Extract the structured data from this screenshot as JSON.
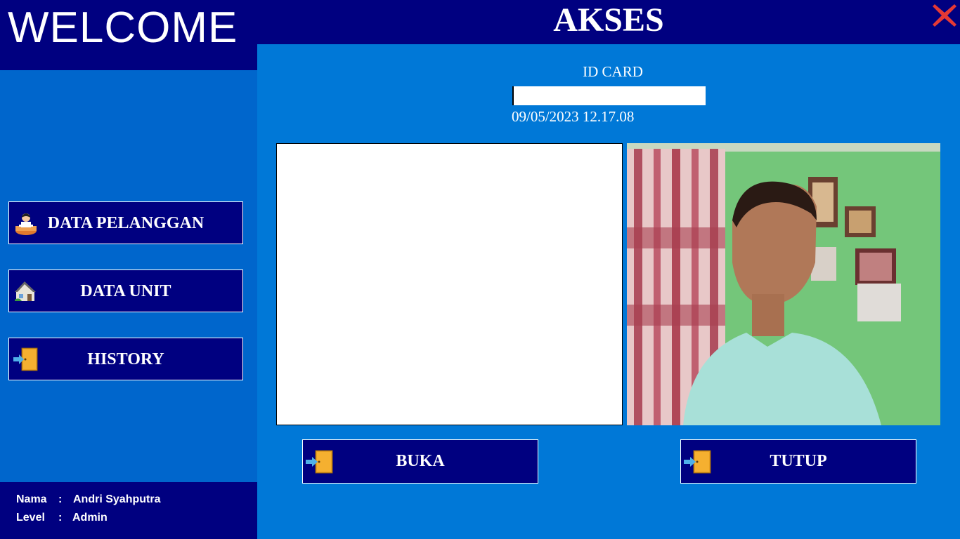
{
  "sidebar": {
    "welcome": "WELCOME",
    "nav": [
      {
        "label": "DATA PELANGGAN",
        "icon": "customer-icon"
      },
      {
        "label": "DATA UNIT",
        "icon": "house-icon"
      },
      {
        "label": "HISTORY",
        "icon": "door-exit-icon"
      }
    ],
    "user": {
      "name_label": "Nama",
      "name_value": "Andri Syahputra",
      "level_label": "Level",
      "level_value": "Admin",
      "separator": ":"
    }
  },
  "main": {
    "title": "AKSES",
    "id_card_label": "ID CARD",
    "id_card_value": "",
    "datetime": "09/05/2023 12.17.08",
    "buttons": {
      "open": "BUKA",
      "close": "TUTUP"
    }
  },
  "colors": {
    "navy": "#000080",
    "sidebar_blue": "#0066cc",
    "main_blue": "#0078d7",
    "close_red": "#e53935"
  }
}
